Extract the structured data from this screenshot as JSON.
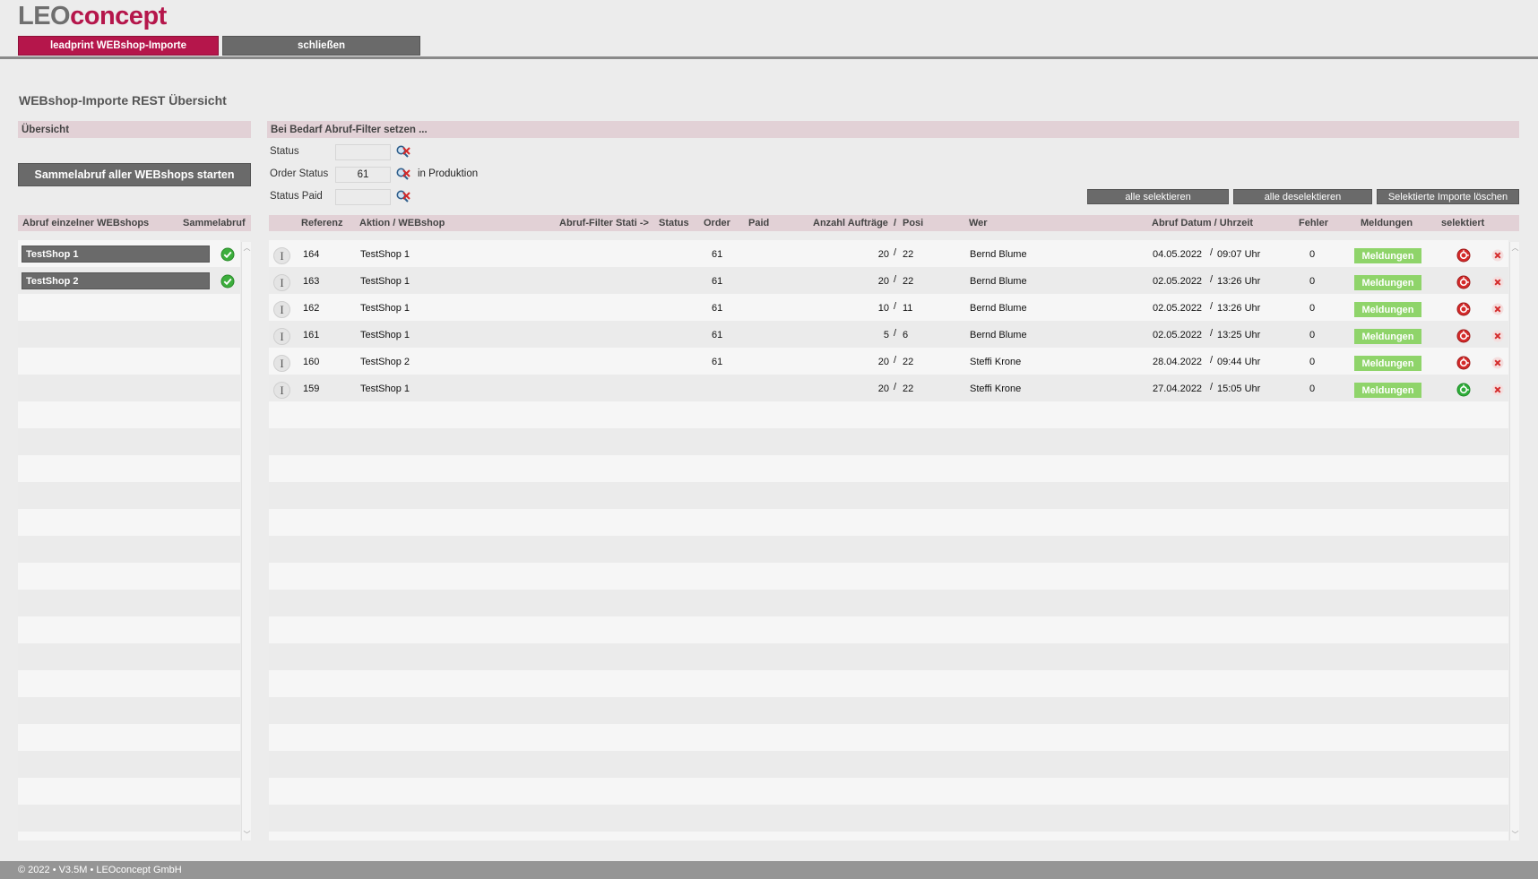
{
  "logo": {
    "part1": "LEO",
    "part2": "concept"
  },
  "nav": {
    "active_tab": "leadprint WEBshop-Importe",
    "close": "schließen"
  },
  "page_title": "WEBshop-Importe REST Übersicht",
  "overview_label": "Übersicht",
  "filter_header": "Bei Bedarf Abruf-Filter setzen ...",
  "collect_button": "Sammelabruf aller WEBshops starten",
  "filters": {
    "status": {
      "label": "Status",
      "value": ""
    },
    "order_status": {
      "label": "Order Status",
      "value": "61",
      "note": "in Produktion"
    },
    "status_paid": {
      "label": "Status Paid",
      "value": ""
    }
  },
  "actions": {
    "select_all": "alle selektieren",
    "deselect_all": "alle deselektieren",
    "delete_selected": "Selektierte Importe löschen"
  },
  "left_header": {
    "col1": "Abruf einzelner WEBshops",
    "col2": "Sammelabruf"
  },
  "shops": [
    {
      "name": "TestShop 1"
    },
    {
      "name": "TestShop 2"
    }
  ],
  "table_header": {
    "ref": "Referenz",
    "action": "Aktion / WEBshop",
    "filter": "Abruf-Filter Stati ->",
    "status": "Status",
    "order": "Order",
    "paid": "Paid",
    "count": "Anzahl Aufträge",
    "sep": "/",
    "posi": "Posi",
    "who": "Wer",
    "date": "Abruf Datum / Uhrzeit",
    "errors": "Fehler",
    "messages": "Meldungen",
    "selected": "selektiert"
  },
  "rows": [
    {
      "ref": "164",
      "shop": "TestShop 1",
      "order": "61",
      "count": "20",
      "sep": "/",
      "posi": "22",
      "who": "Bernd Blume",
      "date": "04.05.2022",
      "dsep": "/",
      "time": "09:07 Uhr",
      "errors": "0",
      "messages": "Meldungen",
      "sel_color": "red"
    },
    {
      "ref": "163",
      "shop": "TestShop 1",
      "order": "61",
      "count": "20",
      "sep": "/",
      "posi": "22",
      "who": "Bernd Blume",
      "date": "02.05.2022",
      "dsep": "/",
      "time": "13:26 Uhr",
      "errors": "0",
      "messages": "Meldungen",
      "sel_color": "red"
    },
    {
      "ref": "162",
      "shop": "TestShop 1",
      "order": "61",
      "count": "10",
      "sep": "/",
      "posi": "11",
      "who": "Bernd Blume",
      "date": "02.05.2022",
      "dsep": "/",
      "time": "13:26 Uhr",
      "errors": "0",
      "messages": "Meldungen",
      "sel_color": "red"
    },
    {
      "ref": "161",
      "shop": "TestShop 1",
      "order": "61",
      "count": "5",
      "sep": "/",
      "posi": "6",
      "who": "Bernd Blume",
      "date": "02.05.2022",
      "dsep": "/",
      "time": "13:25 Uhr",
      "errors": "0",
      "messages": "Meldungen",
      "sel_color": "red"
    },
    {
      "ref": "160",
      "shop": "TestShop 2",
      "order": "61",
      "count": "20",
      "sep": "/",
      "posi": "22",
      "who": "Steffi Krone",
      "date": "28.04.2022",
      "dsep": "/",
      "time": "09:44 Uhr",
      "errors": "0",
      "messages": "Meldungen",
      "sel_color": "red"
    },
    {
      "ref": "159",
      "shop": "TestShop 1",
      "order": "",
      "count": "20",
      "sep": "/",
      "posi": "22",
      "who": "Steffi Krone",
      "date": "27.04.2022",
      "dsep": "/",
      "time": "15:05 Uhr",
      "errors": "0",
      "messages": "Meldungen",
      "sel_color": "green"
    }
  ],
  "icons": {
    "info": "info-icon",
    "filter_clear": "filter-clear-icon",
    "check": "check-icon",
    "select": "select-toggle-icon",
    "delete": "delete-icon"
  },
  "colors": {
    "brand": "#b5164b",
    "button_gray": "#6a6a6a",
    "header_pink": "#e2d1d6",
    "messages_green": "#8fd46a",
    "select_red": "#d42a2a",
    "select_green": "#2fae3a"
  },
  "footer": "© 2022 • V3.5M • LEOconcept GmbH"
}
